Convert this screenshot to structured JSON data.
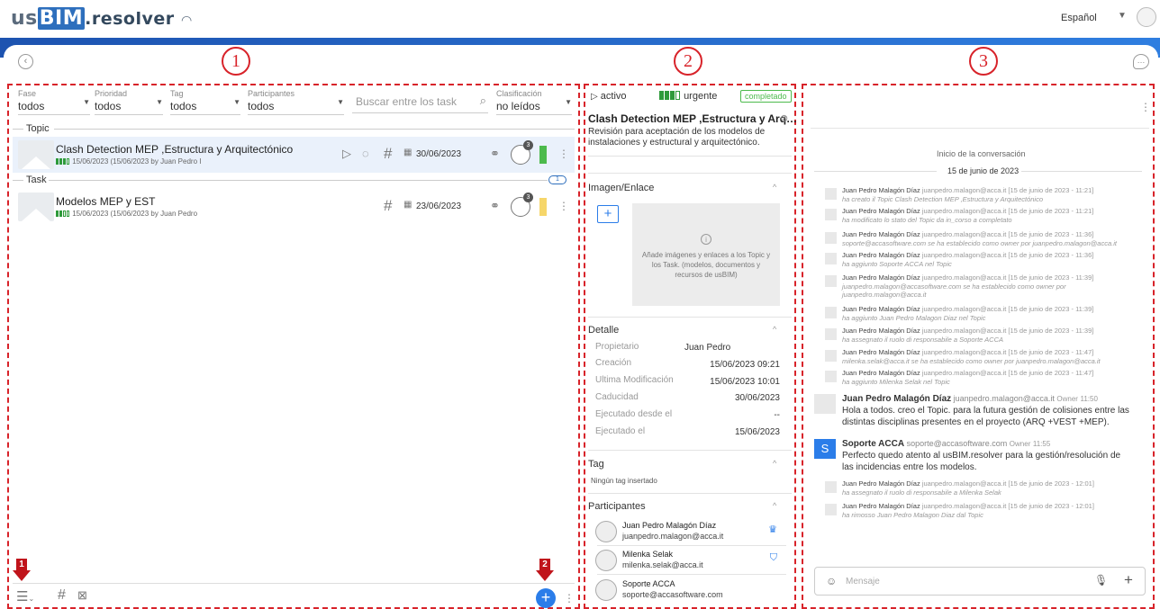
{
  "header": {
    "logo_us": "us",
    "logo_bim": "BIM",
    "logo_res": ".resolver",
    "language": "Español"
  },
  "markers": {
    "p1": "1",
    "p2": "2",
    "p3": "3",
    "a1": "1",
    "a2": "2"
  },
  "filters": [
    {
      "label": "Fase",
      "value": "todos"
    },
    {
      "label": "Prioridad",
      "value": "todos"
    },
    {
      "label": "Tag",
      "value": "todos"
    },
    {
      "label": "Participantes",
      "value": "todos"
    },
    {
      "label": "Clasificación",
      "value": "no leídos"
    }
  ],
  "search": {
    "placeholder": "Buscar entre los task"
  },
  "sections": {
    "topic": "Topic",
    "task": "Task",
    "task_count": "1"
  },
  "topic_row": {
    "title": "Clash Detection MEP ,Estructura y Arquitectónico",
    "sub": "15/06/2023 (15/06/2023 by Juan Pedro I",
    "due": "30/06/2023",
    "badge": "3",
    "bar_color": "#4cba4c"
  },
  "task_row": {
    "title": "Modelos MEP y EST",
    "sub": "15/06/2023 (15/06/2023 by Juan Pedro",
    "due": "23/06/2023",
    "badge": "3",
    "bar_color": "#f6d66a"
  },
  "detail": {
    "status": "activo",
    "priority": "urgente",
    "state": "completado",
    "title": "Clash Detection MEP ,Estructura y Arq…",
    "description": "Revisión para aceptación de los modelos de instalaciones y estructural y arquitectónico.",
    "image_section": "Imagen/Enlace",
    "image_hint": "Añade imágenes y enlaces a los Topic y los Task. (modelos, documentos y recursos de usBIM)",
    "detail_section": "Detalle",
    "fields": [
      {
        "label": "Propietario",
        "value": "Juan Pedro"
      },
      {
        "label": "Creación",
        "value": "15/06/2023 09:21"
      },
      {
        "label": "Ultima Modificación",
        "value": "15/06/2023 10:01"
      },
      {
        "label": "Caducidad",
        "value": "30/06/2023"
      },
      {
        "label": "Ejecutado desde el",
        "value": "--"
      },
      {
        "label": "Ejecutado el",
        "value": "15/06/2023"
      }
    ],
    "tag_section": "Tag",
    "tag_empty": "Ningún tag insertado",
    "participants_section": "Participantes",
    "participants": [
      {
        "name": "Juan Pedro Malagón Díaz",
        "email": "juanpedro.malagon@acca.it",
        "role_icon": "crown-icon"
      },
      {
        "name": "Milenka Selak",
        "email": "milenka.selak@acca.it",
        "role_icon": "shield-icon"
      },
      {
        "name": "Soporte ACCA",
        "email": "soporte@accasoftware.com",
        "role_icon": ""
      }
    ]
  },
  "conversation": {
    "start": "Inicio de la conversación",
    "date": "15 de junio de 2023",
    "logs": [
      {
        "name": "Juan Pedro Malagón Díaz",
        "email": "juanpedro.malagon@acca.it",
        "time": "[15 de junio de 2023 - 11:21]",
        "text": "ha creato il Topic Clash Detection MEP ,Estructura y Arquitectónico"
      },
      {
        "name": "Juan Pedro Malagón Díaz",
        "email": "juanpedro.malagon@acca.it",
        "time": "[15 de junio de 2023 - 11:21]",
        "text": "ha modificato lo stato del Topic da in_corso a completato"
      },
      {
        "name": "Juan Pedro Malagón Díaz",
        "email": "juanpedro.malagon@acca.it",
        "time": "[15 de junio de 2023 - 11:36]",
        "text": "soporte@accasoftware.com se ha establecido como owner por juanpedro.malagon@acca.it"
      },
      {
        "name": "Juan Pedro Malagón Díaz",
        "email": "juanpedro.malagon@acca.it",
        "time": "[15 de junio de 2023 - 11:36]",
        "text": "ha aggiunto Soporte ACCA nel Topic"
      },
      {
        "name": "Juan Pedro Malagón Díaz",
        "email": "juanpedro.malagon@acca.it",
        "time": "[15 de junio de 2023 - 11:39]",
        "text": "juanpedro.malagon@accasoftware.com se ha establecido como owner por",
        "text2": "juanpedro.malagon@acca.it"
      },
      {
        "name": "Juan Pedro Malagón Díaz",
        "email": "juanpedro.malagon@acca.it",
        "time": "[15 de junio de 2023 - 11:39]",
        "text": "ha aggiunto Juan Pedro Malagon Diaz nel Topic"
      },
      {
        "name": "Juan Pedro Malagón Díaz",
        "email": "juanpedro.malagon@acca.it",
        "time": "[15 de junio de 2023 - 11:39]",
        "text": "ha assegnato il ruolo di responsabile a Soporte ACCA"
      },
      {
        "name": "Juan Pedro Malagón Díaz",
        "email": "juanpedro.malagon@acca.it",
        "time": "[15 de junio de 2023 - 11:47]",
        "text": "milenka.selak@acca.it se ha establecido como owner por juanpedro.malagon@acca.it"
      },
      {
        "name": "Juan Pedro Malagón Díaz",
        "email": "juanpedro.malagon@acca.it",
        "time": "[15 de junio de 2023 - 11:47]",
        "text": "ha aggiunto Milenka Selak nel Topic"
      }
    ],
    "msg1": {
      "name": "Juan Pedro Malagón Díaz",
      "email": "juanpedro.malagon@acca.it",
      "tag": "Owner",
      "time": "11:50",
      "text": "Hola a todos. creo el Topic. para la futura gestión de colisiones entre las distintas disciplinas presentes en el proyecto (ARQ +VEST +MEP)."
    },
    "msg2": {
      "initial": "S",
      "name": "Soporte ACCA",
      "email": "soporte@accasoftware.com",
      "tag": "Owner",
      "time": "11:55",
      "text": "Perfecto quedo atento al usBIM.resolver para la gestión/resolución de las incidencias entre los modelos."
    },
    "logs2": [
      {
        "name": "Juan Pedro Malagón Díaz",
        "email": "juanpedro.malagon@acca.it",
        "time": "[15 de junio de 2023 - 12:01]",
        "text": "ha assegnato il ruolo di responsabile a Milenka Selak"
      },
      {
        "name": "Juan Pedro Malagón Díaz",
        "email": "juanpedro.malagon@acca.it",
        "time": "[15 de junio de 2023 - 12:01]",
        "text": "ha rimosso Juan Pedro Malagon Diaz dal Topic"
      }
    ],
    "input_placeholder": "Mensaje"
  }
}
